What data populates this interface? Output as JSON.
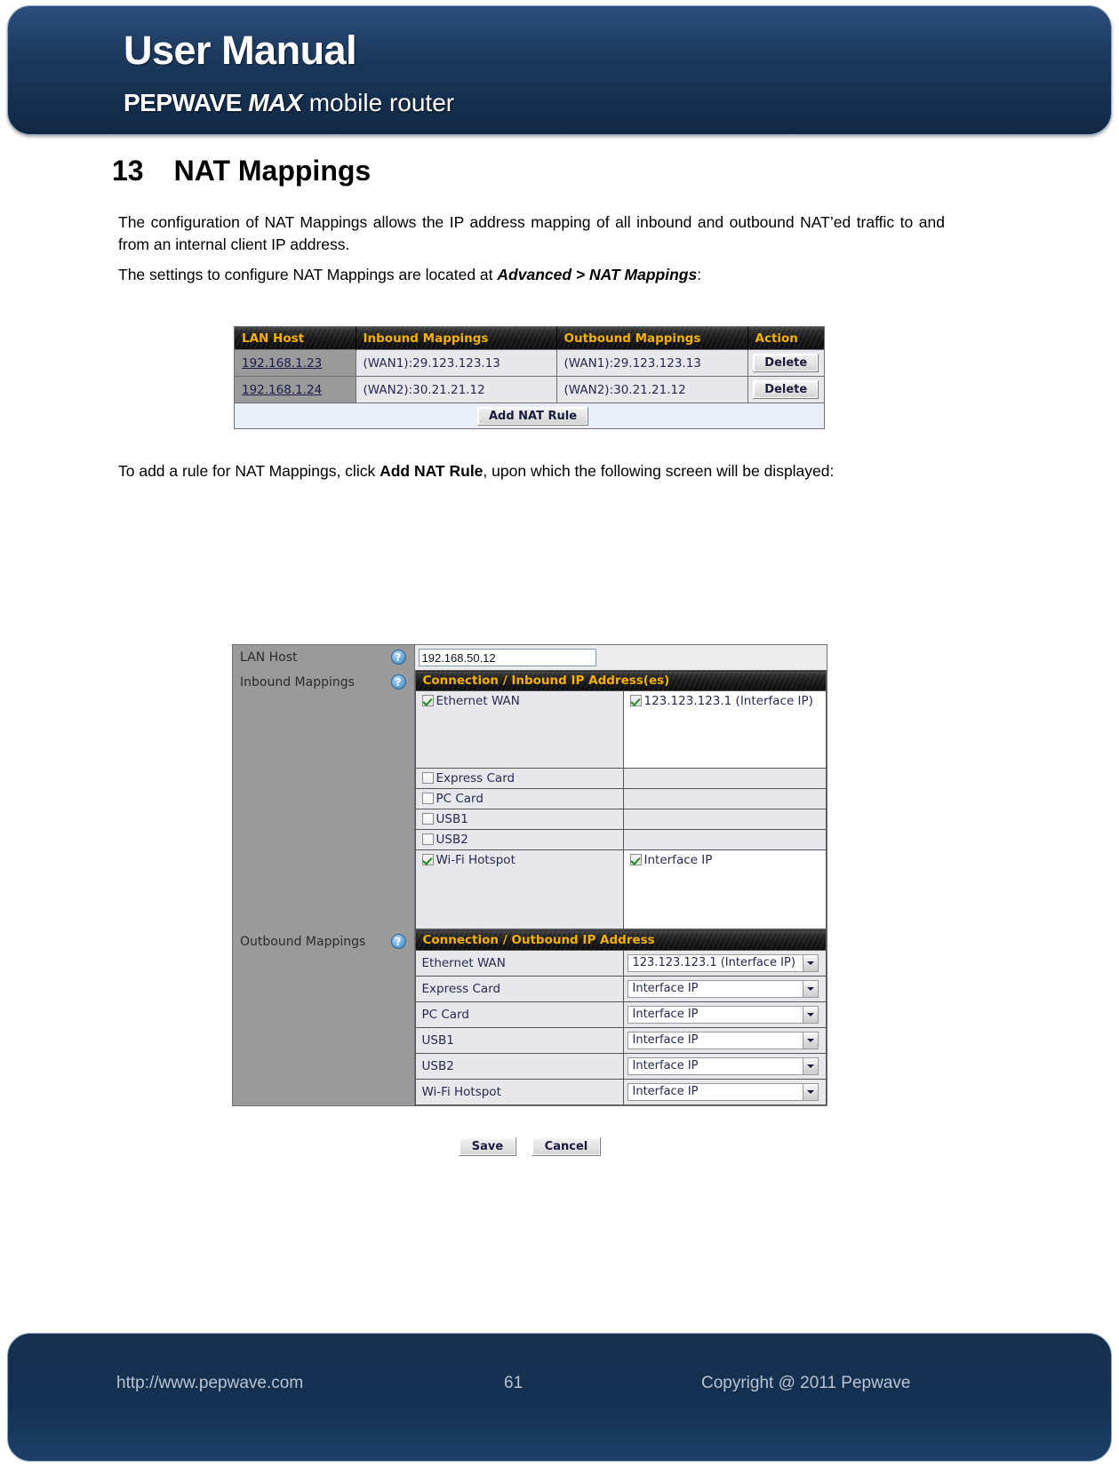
{
  "banner": {
    "title": "User Manual",
    "brand_1": "PEPWAVE ",
    "brand_2": "MAX",
    "brand_3": " mobile router"
  },
  "chapter": {
    "number": "13",
    "title": "NAT Mappings"
  },
  "paragraphs": {
    "p1": "The configuration of NAT Mappings allows the IP address mapping of all inbound and outbound NAT’ed traffic to and from an internal client IP address.",
    "p2_prefix": "The settings to configure NAT Mappings are located at ",
    "p2_bold": "Advanced > NAT Mappings",
    "p2_suffix": ":",
    "p3_prefix": "To add a rule for NAT Mappings, click ",
    "p3_bold": "Add NAT Rule",
    "p3_suffix": ", upon which the following screen will be displayed:"
  },
  "nat_list": {
    "columns": [
      "LAN Host",
      "Inbound Mappings",
      "Outbound Mappings",
      "Action"
    ],
    "rows": [
      {
        "lan_host": "192.168.1.23",
        "inbound": "(WAN1):29.123.123.13",
        "outbound": "(WAN1):29.123.123.13",
        "action": "Delete"
      },
      {
        "lan_host": "192.168.1.24",
        "inbound": "(WAN2):30.21.21.12",
        "outbound": "(WAN2):30.21.21.12",
        "action": "Delete"
      }
    ],
    "add_button": "Add NAT Rule"
  },
  "nat_form": {
    "lan_host": {
      "label": "LAN Host",
      "help": "?",
      "value": "192.168.50.12"
    },
    "inbound": {
      "label": "Inbound Mappings",
      "help": "?",
      "table_header": "Connection / Inbound IP Address(es)",
      "rows": [
        {
          "name": "Ethernet WAN",
          "checked": true,
          "tall": true,
          "addresses": [
            {
              "label": "123.123.123.1 (Interface IP)",
              "checked": true
            }
          ]
        },
        {
          "name": "Express Card",
          "checked": false,
          "tall": false,
          "addresses": []
        },
        {
          "name": "PC Card",
          "checked": false,
          "tall": false,
          "addresses": []
        },
        {
          "name": "USB1",
          "checked": false,
          "tall": false,
          "addresses": []
        },
        {
          "name": "USB2",
          "checked": false,
          "tall": false,
          "addresses": []
        },
        {
          "name": "Wi-Fi Hotspot",
          "checked": true,
          "tall": true,
          "addresses": [
            {
              "label": "Interface IP",
              "checked": true
            }
          ]
        }
      ]
    },
    "outbound": {
      "label": "Outbound Mappings",
      "help": "?",
      "table_header": "Connection / Outbound IP Address",
      "rows": [
        {
          "name": "Ethernet WAN",
          "selected": "123.123.123.1 (Interface IP)"
        },
        {
          "name": "Express Card",
          "selected": "Interface IP"
        },
        {
          "name": "PC Card",
          "selected": "Interface IP"
        },
        {
          "name": "USB1",
          "selected": "Interface IP"
        },
        {
          "name": "USB2",
          "selected": "Interface IP"
        },
        {
          "name": "Wi-Fi Hotspot",
          "selected": "Interface IP"
        }
      ]
    },
    "save_label": "Save",
    "cancel_label": "Cancel"
  },
  "footer": {
    "url": "http://www.pepwave.com",
    "page": "61",
    "copyright": "Copyright @ 2011 Pepwave"
  },
  "colors": {
    "banner_blue": "#16304e",
    "header_gold": "#f5b100",
    "link_navy": "#1b1b4b"
  }
}
